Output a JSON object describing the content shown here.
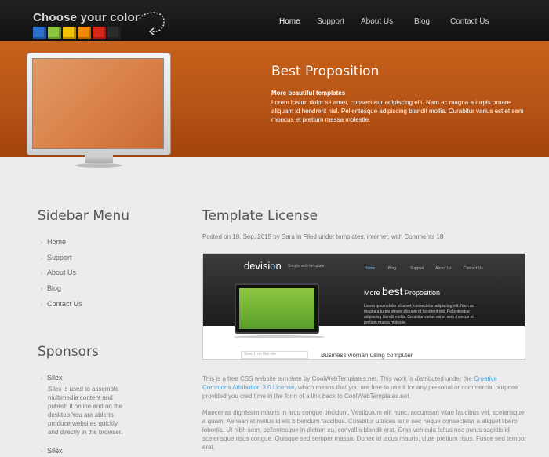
{
  "header": {
    "logo_text": "Choose your color",
    "cube_colors": [
      "#2a6fc9",
      "#8cc63f",
      "#f2c200",
      "#f08a00",
      "#d9261c",
      "#2b2b2b"
    ],
    "nav": [
      {
        "label": "Home",
        "active": true
      },
      {
        "label": "Support",
        "active": false
      },
      {
        "label": "About Us",
        "active": false
      },
      {
        "label": "Blog",
        "active": false
      },
      {
        "label": "Contact Us",
        "active": false
      }
    ]
  },
  "hero": {
    "title": "Best Proposition",
    "subtitle": "More beautiful templates",
    "text": "Lorem ipsum dolor sit amet, consectetur adipiscing elit. Nam ac magna a turpis ornare aliquam id hendrerit nisl. Pellentesque adipiscing blandit mollis. Curabitur varius est et sem rhoncus et pretium massa molestie."
  },
  "sidebar": {
    "menu_title": "Sidebar Menu",
    "menu": [
      "Home",
      "Support",
      "About Us",
      "Blog",
      "Contact Us"
    ],
    "sponsors_title": "Sponsors",
    "sponsors": [
      {
        "name": "Silex",
        "description": "Silex is used to assemble multimedia content and publish it online and on the desktop.You are able to produce websites quickly, and directly in the browser."
      },
      {
        "name": "Silex",
        "description": ""
      }
    ]
  },
  "main": {
    "title": "Template License",
    "meta": "Posted on 18. Sep, 2015 by Sara in Filed under templates, internet, with Comments 18",
    "preview": {
      "logo": "devision",
      "tagline": "Simple web template",
      "nav": [
        "Home",
        "Blog",
        "Support",
        "About Us",
        "Contact Us"
      ],
      "title_pre": "More",
      "title_bold": "best",
      "title_post": "Proposition",
      "text": "Lorem ipsum dolor sit amet, consectetur adipiscing elit. Nam ac magna a turpis ornare aliquam id hendrerit nisl. Pellentesque adipiscing blandit mollis. Curabitur varius est et sem rhoncus et pretium massa molestie.",
      "search_placeholder": "Search on this site",
      "caption": "Business woman using computer"
    },
    "para1_pre": "This is a free CSS website template by CoolWebTemplates.net. This work is distributed under the ",
    "para1_link": "Creative Commons Attribution 3.0 License",
    "para1_post": ", which means that you are free to use it for any personal or commercial purpose provided you credit me in the form of a link back to CoolWebTemplates.net.",
    "para2": "Maecenas dignissim mauris in arcu congue tincidunt. Vestibulum elit nunc, accumsan vitae faucibus vel, scelerisque a quam. Aenean at metus id elit bibendum faucibus. Curabitur ultrices ante nec neque consectetur a aliquet libero lobortis. Ut nibh sem, pellentesque in dictum eu, convallis blandit erat. Cras vehicula tellus nec purus sagittis id scelerisque risus congue. Quisque sed semper massa. Donec id lacus mauris, vitae pretium risus. Fusce sed tempor erat."
  }
}
